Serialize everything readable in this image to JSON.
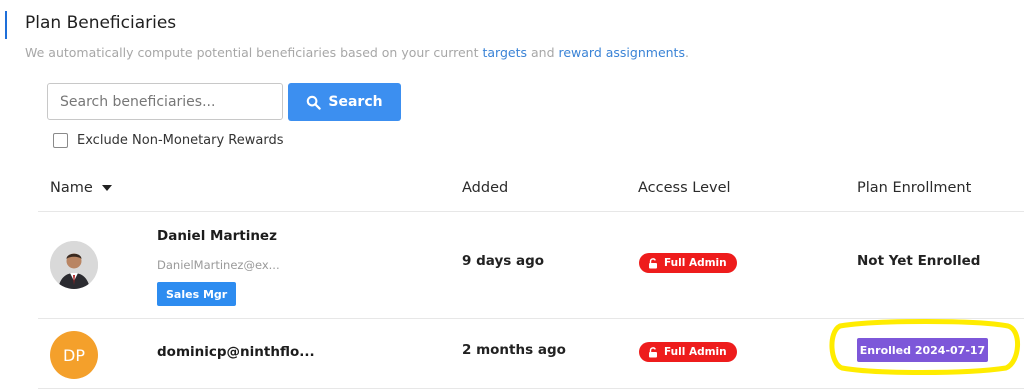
{
  "page": {
    "title": "Plan Beneficiaries",
    "subtitle_prefix": "We automatically compute potential beneficiaries based on your current ",
    "subtitle_link1": "targets",
    "subtitle_mid": " and ",
    "subtitle_link2": "reward assignments",
    "subtitle_suffix": "."
  },
  "search": {
    "placeholder": "Search beneficiaries...",
    "value": "",
    "button_label": "Search"
  },
  "filter": {
    "exclude_label": "Exclude Non-Monetary Rewards",
    "checked": false
  },
  "table": {
    "headers": {
      "name": "Name",
      "added": "Added",
      "access": "Access Level",
      "enrollment": "Plan Enrollment"
    },
    "rows": [
      {
        "name": "Daniel Martinez",
        "email": "DanielMartinez@ex...",
        "role": "Sales Mgr",
        "added": "9 days ago",
        "access": "Full Admin",
        "enrollment": "Not Yet Enrolled"
      },
      {
        "initials": "DP",
        "name": "dominicp@ninthflo...",
        "added": "2 months ago",
        "access": "Full Admin",
        "enrollment": "Enrolled 2024-07-17"
      }
    ]
  },
  "colors": {
    "accent": "#3c8ff0",
    "link": "#3a83d6",
    "access_badge": "#ee1c1c",
    "enrolled_badge": "#7d57d9",
    "avatar_initials_bg": "#f4a02b",
    "highlight": "#ffec00"
  },
  "icons": {
    "search": "search-icon",
    "lock": "lock-icon",
    "sort": "caret-down-icon"
  }
}
